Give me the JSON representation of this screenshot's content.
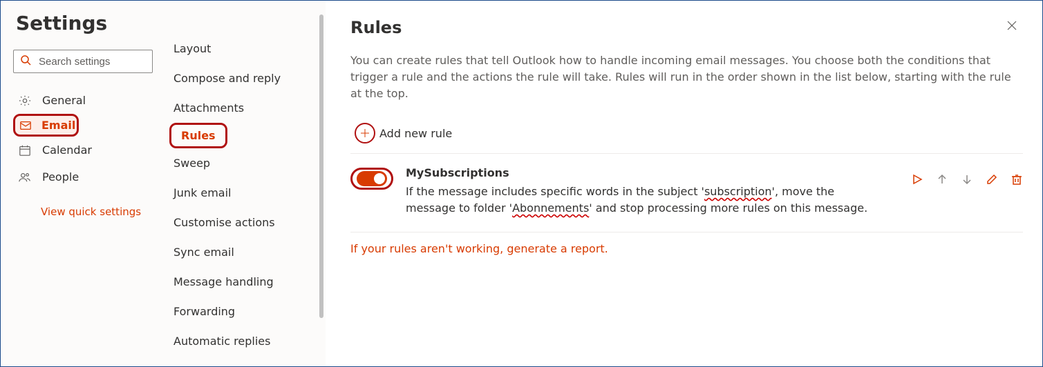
{
  "settings": {
    "title": "Settings",
    "search_placeholder": "Search settings",
    "categories": [
      {
        "id": "general",
        "label": "General",
        "icon": "gear"
      },
      {
        "id": "email",
        "label": "Email",
        "icon": "mail",
        "selected": true,
        "annot": true
      },
      {
        "id": "calendar",
        "label": "Calendar",
        "icon": "calendar"
      },
      {
        "id": "people",
        "label": "People",
        "icon": "people"
      }
    ],
    "quick_link": "View quick settings"
  },
  "subnav": {
    "items": [
      {
        "id": "layout",
        "label": "Layout"
      },
      {
        "id": "compose",
        "label": "Compose and reply"
      },
      {
        "id": "attach",
        "label": "Attachments"
      },
      {
        "id": "rules",
        "label": "Rules",
        "selected": true,
        "annot": true
      },
      {
        "id": "sweep",
        "label": "Sweep"
      },
      {
        "id": "junk",
        "label": "Junk email"
      },
      {
        "id": "custom",
        "label": "Customise actions"
      },
      {
        "id": "sync",
        "label": "Sync email"
      },
      {
        "id": "msg",
        "label": "Message handling"
      },
      {
        "id": "fwd",
        "label": "Forwarding"
      },
      {
        "id": "auto",
        "label": "Automatic replies"
      }
    ]
  },
  "main": {
    "title": "Rules",
    "description": "You can create rules that tell Outlook how to handle incoming email messages. You choose both the conditions that trigger a rule and the actions the rule will take. Rules will run in the order shown in the list below, starting with the rule at the top.",
    "add_label": "Add new rule",
    "rule": {
      "enabled": true,
      "name": "MySubscriptions",
      "desc_pre": "If the message includes specific words in the subject '",
      "desc_word1": "subscription",
      "desc_mid": "', move the message to folder '",
      "desc_word2": "Abonnements",
      "desc_post": "' and stop processing more rules on this message."
    },
    "report_link": "If your rules aren't working, generate a report."
  }
}
